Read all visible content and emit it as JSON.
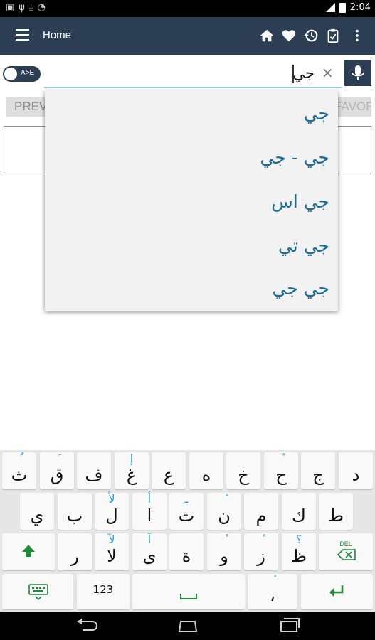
{
  "status_bar": {
    "left_icons": [
      "image-icon",
      "usb-icon",
      "download-icon",
      "wifi-icon"
    ],
    "time": "2:04"
  },
  "app_bar": {
    "title": "Home",
    "icons": [
      "home-icon",
      "heart-icon",
      "history-icon",
      "clipboard-icon",
      "more-icon"
    ]
  },
  "search": {
    "toggle_label": "A>E",
    "query": "جي",
    "clear_symbol": "×"
  },
  "buttons": {
    "previous": "PREVIOUS",
    "favorite": "FAVORITE"
  },
  "suggestions": [
    "جي",
    "جي - جي",
    "جي اس",
    "جي تي",
    "جي جي"
  ],
  "keyboard": {
    "rows": [
      [
        {
          "main": "ث",
          "sub": "ُ"
        },
        {
          "main": "ق",
          "sub": "َ"
        },
        {
          "main": "ف",
          "sub": ""
        },
        {
          "main": "غ",
          "sub": "إ"
        },
        {
          "main": "ع",
          "sub": ""
        },
        {
          "main": "ه",
          "sub": ""
        },
        {
          "main": "خ",
          "sub": ""
        },
        {
          "main": "ح",
          "sub": "ٔ"
        },
        {
          "main": "ج",
          "sub": ""
        },
        {
          "main": "د",
          "sub": ""
        }
      ],
      [
        {
          "main": "ي",
          "sub": ""
        },
        {
          "main": "ب",
          "sub": ""
        },
        {
          "main": "ل",
          "sub": "لأ"
        },
        {
          "main": "ا",
          "sub": "أ"
        },
        {
          "main": "ت",
          "sub": "ـ"
        },
        {
          "main": "ن",
          "sub": "ٔ"
        },
        {
          "main": "م",
          "sub": ""
        },
        {
          "main": "ك",
          "sub": ""
        },
        {
          "main": "ط",
          "sub": ""
        }
      ],
      [
        {
          "main": "ر",
          "sub": ""
        },
        {
          "main": "لا",
          "sub": "لآ"
        },
        {
          "main": "ى",
          "sub": "آ"
        },
        {
          "main": "ة",
          "sub": ""
        },
        {
          "main": "و",
          "sub": "ٔ"
        },
        {
          "main": "ز",
          "sub": "ٔ"
        },
        {
          "main": "ظ",
          "sub": "؟"
        }
      ],
      [
        {
          "main": "123",
          "sub": ""
        },
        {
          "main": "،",
          "sub": "ٔ"
        }
      ]
    ],
    "del_label": "DEL"
  },
  "colors": {
    "app_bar": "#2b3e54",
    "suggestion_text": "#1d6c93",
    "key_sub": "#27a0e0",
    "key_green": "#1f8a3a"
  }
}
